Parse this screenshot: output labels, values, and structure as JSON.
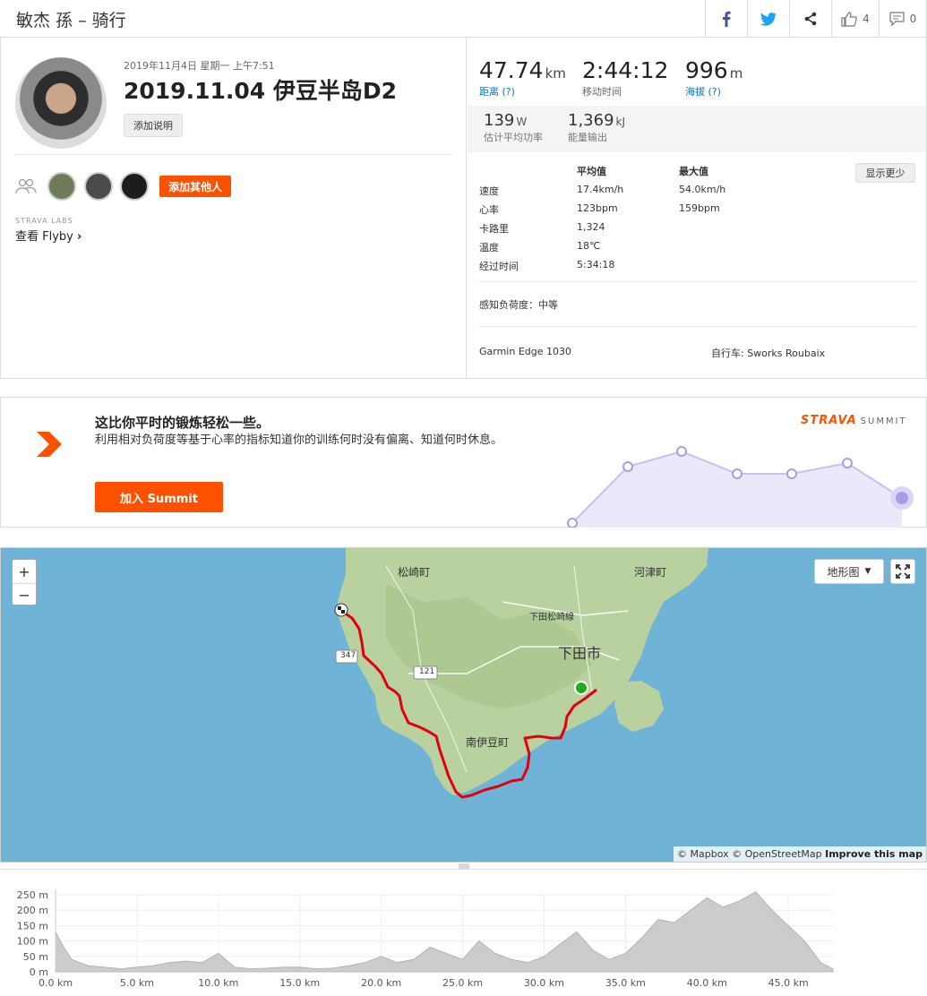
{
  "header": {
    "title": "敏杰 孫 – 骑行",
    "kudos_count": "4",
    "comment_count": "0"
  },
  "activity": {
    "date": "2019年11月4日 星期一 上午7:51",
    "title": "2019.11.04 伊豆半岛D2",
    "add_description": "添加说明",
    "add_others": "添加其他人",
    "labs_label": "STRAVA LABS",
    "flyby_label": "查看 Flyby",
    "stats": [
      {
        "value": "47.74",
        "unit": "km",
        "label": "距离 (?)"
      },
      {
        "value": "2:44:12",
        "unit": "",
        "label": "移动时间"
      },
      {
        "value": "996",
        "unit": "m",
        "label": "海拔 (?)"
      }
    ],
    "stats_secondary": [
      {
        "value": "139",
        "unit": "W",
        "label": "估计平均功率"
      },
      {
        "value": "1,369",
        "unit": "kJ",
        "label": "能量输出"
      }
    ],
    "table": {
      "col_avg": "平均值",
      "col_max": "最大值",
      "rows": [
        {
          "label": "速度",
          "avg": "17.4km/h",
          "max": "54.0km/h"
        },
        {
          "label": "心率",
          "avg": "123bpm",
          "max": "159bpm"
        },
        {
          "label": "卡路里",
          "avg": "1,324",
          "max": ""
        },
        {
          "label": "温度",
          "avg": "18℃",
          "max": ""
        },
        {
          "label": "经过时间",
          "avg": "5:34:18",
          "max": ""
        }
      ]
    },
    "show_less": "显示更少",
    "perceived_effort": "感知负荷度：中等",
    "device": "Garmin Edge 1030",
    "bike": "自行车: Sworks Roubaix"
  },
  "summit": {
    "headline": "这比你平时的锻炼轻松一些。",
    "body": "利用相对负荷度等基于心率的指标知道你的训练何时没有偏离、知道何时休息。",
    "join_button": "加入 Summit",
    "logo_brand": "STRAVA",
    "logo_suffix": "SUMMIT"
  },
  "map": {
    "zoom_in": "+",
    "zoom_out": "−",
    "map_type": "地形图",
    "labels": {
      "matsuzaki": "松崎町",
      "kawazu": "河津町",
      "shimoda": "下田市",
      "minamiizu": "南伊豆町",
      "road_shimoda": "下田松崎線",
      "r347": "347",
      "r121": "121"
    },
    "attribution_mapbox": "© Mapbox",
    "attribution_osm": "© OpenStreetMap",
    "attribution_improve": "Improve this map"
  },
  "colors": {
    "accent": "#fc5200",
    "route": "#e0000f",
    "water": "#6fb3d6",
    "land": "#b7cf9e"
  },
  "chart_data": {
    "type": "area",
    "title": "",
    "xlabel": "",
    "ylabel": "",
    "x_ticks": [
      "0.0 km",
      "5.0 km",
      "10.0 km",
      "15.0 km",
      "20.0 km",
      "25.0 km",
      "30.0 km",
      "35.0 km",
      "40.0 km",
      "45.0 km"
    ],
    "y_ticks": [
      "0 m",
      "50 m",
      "100 m",
      "150 m",
      "200 m",
      "250 m"
    ],
    "xlim": [
      0,
      47.74
    ],
    "ylim": [
      0,
      250
    ],
    "x": [
      0,
      0.5,
      1,
      2,
      3,
      4,
      5,
      6,
      7,
      8,
      9,
      10,
      11,
      12,
      13,
      14,
      15,
      16,
      17,
      18,
      19,
      20,
      21,
      22,
      23,
      24,
      25,
      26,
      27,
      28,
      29,
      30,
      31,
      32,
      33,
      34,
      35,
      36,
      37,
      38,
      39,
      40,
      41,
      42,
      43,
      44,
      45,
      46,
      47,
      47.74
    ],
    "y": [
      130,
      80,
      40,
      20,
      15,
      10,
      15,
      20,
      30,
      35,
      30,
      60,
      15,
      10,
      12,
      15,
      15,
      10,
      12,
      20,
      30,
      50,
      30,
      40,
      80,
      60,
      40,
      100,
      60,
      40,
      30,
      50,
      90,
      130,
      70,
      40,
      60,
      110,
      170,
      160,
      200,
      240,
      210,
      230,
      260,
      200,
      150,
      100,
      30,
      10
    ],
    "grid": true
  }
}
